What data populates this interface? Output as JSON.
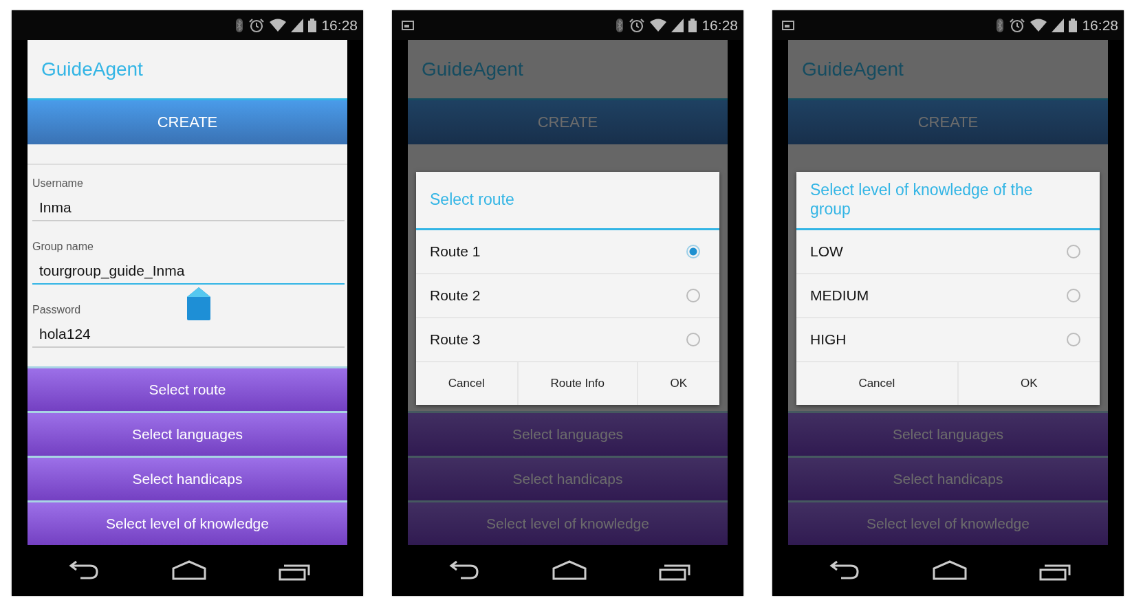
{
  "phones": [
    {
      "status_bar": {
        "notification": false,
        "time": "16:28"
      },
      "app_title": "GuideAgent",
      "create_button": "CREATE",
      "fields": [
        {
          "label": "Username",
          "value": "Inma",
          "focused": false
        },
        {
          "label": "Group name",
          "value": "tourgroup_guide_Inma",
          "focused": true
        },
        {
          "label": "Password",
          "value": "hola124",
          "focused": false
        }
      ],
      "menu_buttons": [
        "Select route",
        "Select languages",
        "Select handicaps",
        "Select level of knowledge"
      ]
    },
    {
      "status_bar": {
        "notification": true,
        "time": "16:28"
      },
      "app_title": "GuideAgent",
      "create_button": "CREATE",
      "menu_buttons": [
        "Select languages",
        "Select handicaps",
        "Select level of knowledge"
      ],
      "dialog": {
        "title": "Select route",
        "options": [
          {
            "label": "Route 1",
            "selected": true
          },
          {
            "label": "Route 2",
            "selected": false
          },
          {
            "label": "Route 3",
            "selected": false
          }
        ],
        "buttons": [
          "Cancel",
          "Route Info",
          "OK"
        ]
      }
    },
    {
      "status_bar": {
        "notification": true,
        "time": "16:28"
      },
      "app_title": "GuideAgent",
      "create_button": "CREATE",
      "menu_buttons": [
        "Select languages",
        "Select handicaps",
        "Select level of knowledge"
      ],
      "dialog": {
        "title": "Select level of knowledge of the group",
        "options": [
          {
            "label": "LOW",
            "selected": false
          },
          {
            "label": "MEDIUM",
            "selected": false
          },
          {
            "label": "HIGH",
            "selected": false
          }
        ],
        "buttons": [
          "Cancel",
          "OK"
        ]
      }
    }
  ]
}
